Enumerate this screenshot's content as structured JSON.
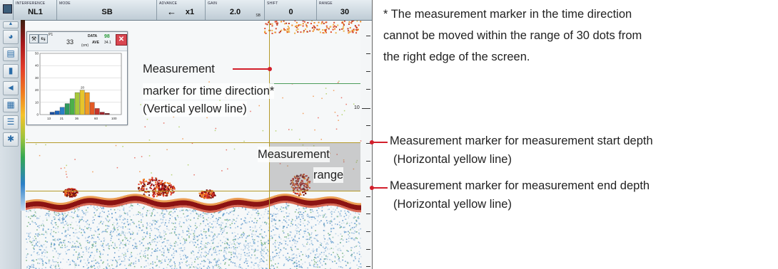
{
  "topbar": {
    "items": [
      {
        "label": "INTERFERENCE",
        "value": "NL1",
        "sub": ""
      },
      {
        "label": "MODE",
        "value": "SB",
        "sub": ""
      },
      {
        "label": "ADVANCE",
        "value": "x1",
        "sub": ""
      },
      {
        "label": "GAIN",
        "value": "2.0",
        "sub": "SB"
      },
      {
        "label": "SHIFT",
        "value": "0",
        "sub": ""
      },
      {
        "label": "RANGE",
        "value": "30",
        "sub": ""
      }
    ]
  },
  "sidebar": {
    "icons": [
      "menu-icon",
      "fish-icon",
      "seabed-icon",
      "bar-chart-icon",
      "speaker-icon",
      "split-screen-icon",
      "table-icon",
      "tools-icon"
    ]
  },
  "depth_ruler": {
    "label_10": "10"
  },
  "popup": {
    "p1": "P1",
    "count": "33",
    "data_label": "DATA",
    "data_value": "98",
    "ave_label": "AVE",
    "ave_value": "34.1",
    "unit": "(cm)",
    "y_ticks": [
      "50",
      "40",
      "30",
      "20",
      "10",
      "0"
    ],
    "x_ticks": [
      "13",
      "21",
      "36",
      "60",
      "100"
    ],
    "peak_label": "20",
    "histogram_bars": [
      2,
      3,
      6,
      9,
      13,
      18,
      20,
      18,
      10,
      5,
      2,
      1
    ],
    "bar_colors": [
      "#1c4fa0",
      "#1e63b9",
      "#2a7fc8",
      "#2f9a5c",
      "#4cb04a",
      "#a7c93b",
      "#e6c52b",
      "#f09a25",
      "#e45a25",
      "#c8342b",
      "#a2232a",
      "#7a1a20"
    ]
  },
  "callouts": {
    "time_marker": [
      "Measurement",
      "marker for time direction*",
      "(Vertical yellow line)"
    ],
    "range": [
      "Measurement",
      "range"
    ],
    "start_depth": [
      "Measurement marker for measurement start depth",
      "(Horizontal yellow line)"
    ],
    "end_depth": [
      "Measurement marker for measurement end depth",
      "(Horizontal yellow line)"
    ]
  },
  "note": [
    "* The measurement marker in the time direction",
    "cannot be moved within the range of 30 dots from",
    "the right edge of the screen."
  ],
  "colors": {
    "yellow_marker": "#b59a2a",
    "callout_red": "#d21f2b",
    "seabed_red": "#a4161a"
  }
}
